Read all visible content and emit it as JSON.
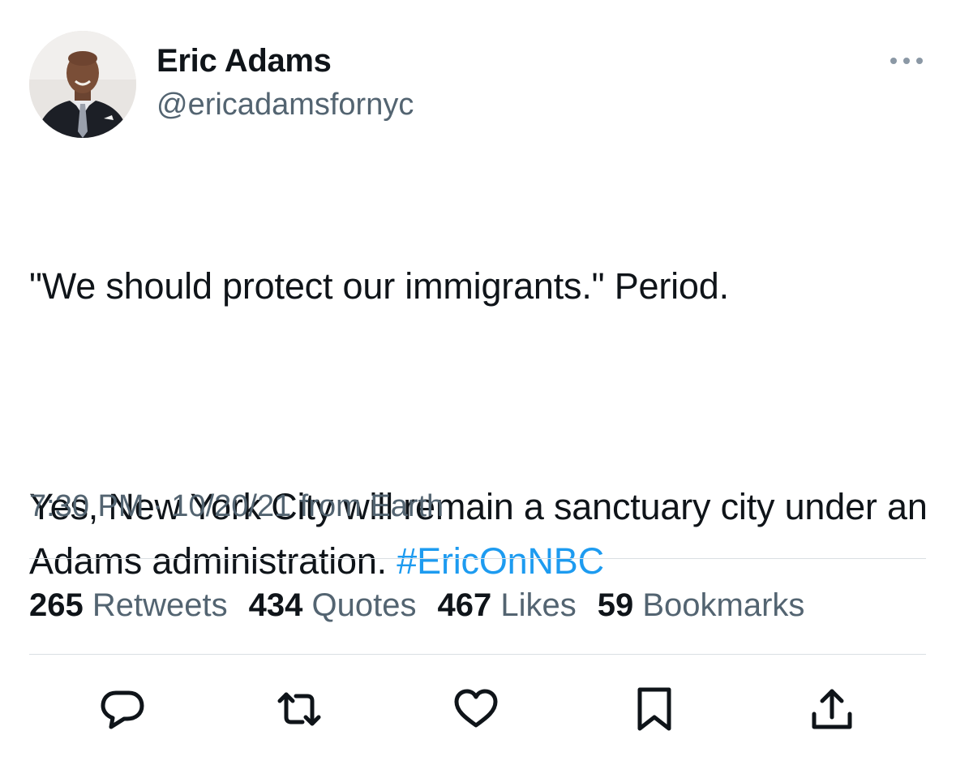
{
  "author": {
    "name": "Eric Adams",
    "handle": "@ericadamsfornyc",
    "avatar_icon": "profile-photo"
  },
  "tweet": {
    "line1": "\"We should protect our immigrants.\" Period.",
    "line2": "Yes, New York City will remain a sanctuary city under an Adams administration. ",
    "hashtag": "#EricOnNBC",
    "time": "7:30 PM",
    "separator": "·",
    "date": "10/20/21",
    "source": "from Earth"
  },
  "stats": {
    "retweets": {
      "count": "265",
      "label": "Retweets"
    },
    "quotes": {
      "count": "434",
      "label": "Quotes"
    },
    "likes": {
      "count": "467",
      "label": "Likes"
    },
    "bookmarks": {
      "count": "59",
      "label": "Bookmarks"
    }
  },
  "actions": [
    "reply-icon",
    "retweet-icon",
    "like-icon",
    "bookmark-icon",
    "share-icon"
  ],
  "colors": {
    "text": "#0f1419",
    "secondary": "#536471",
    "link": "#1d9bf0",
    "divider": "#dadfe3"
  }
}
